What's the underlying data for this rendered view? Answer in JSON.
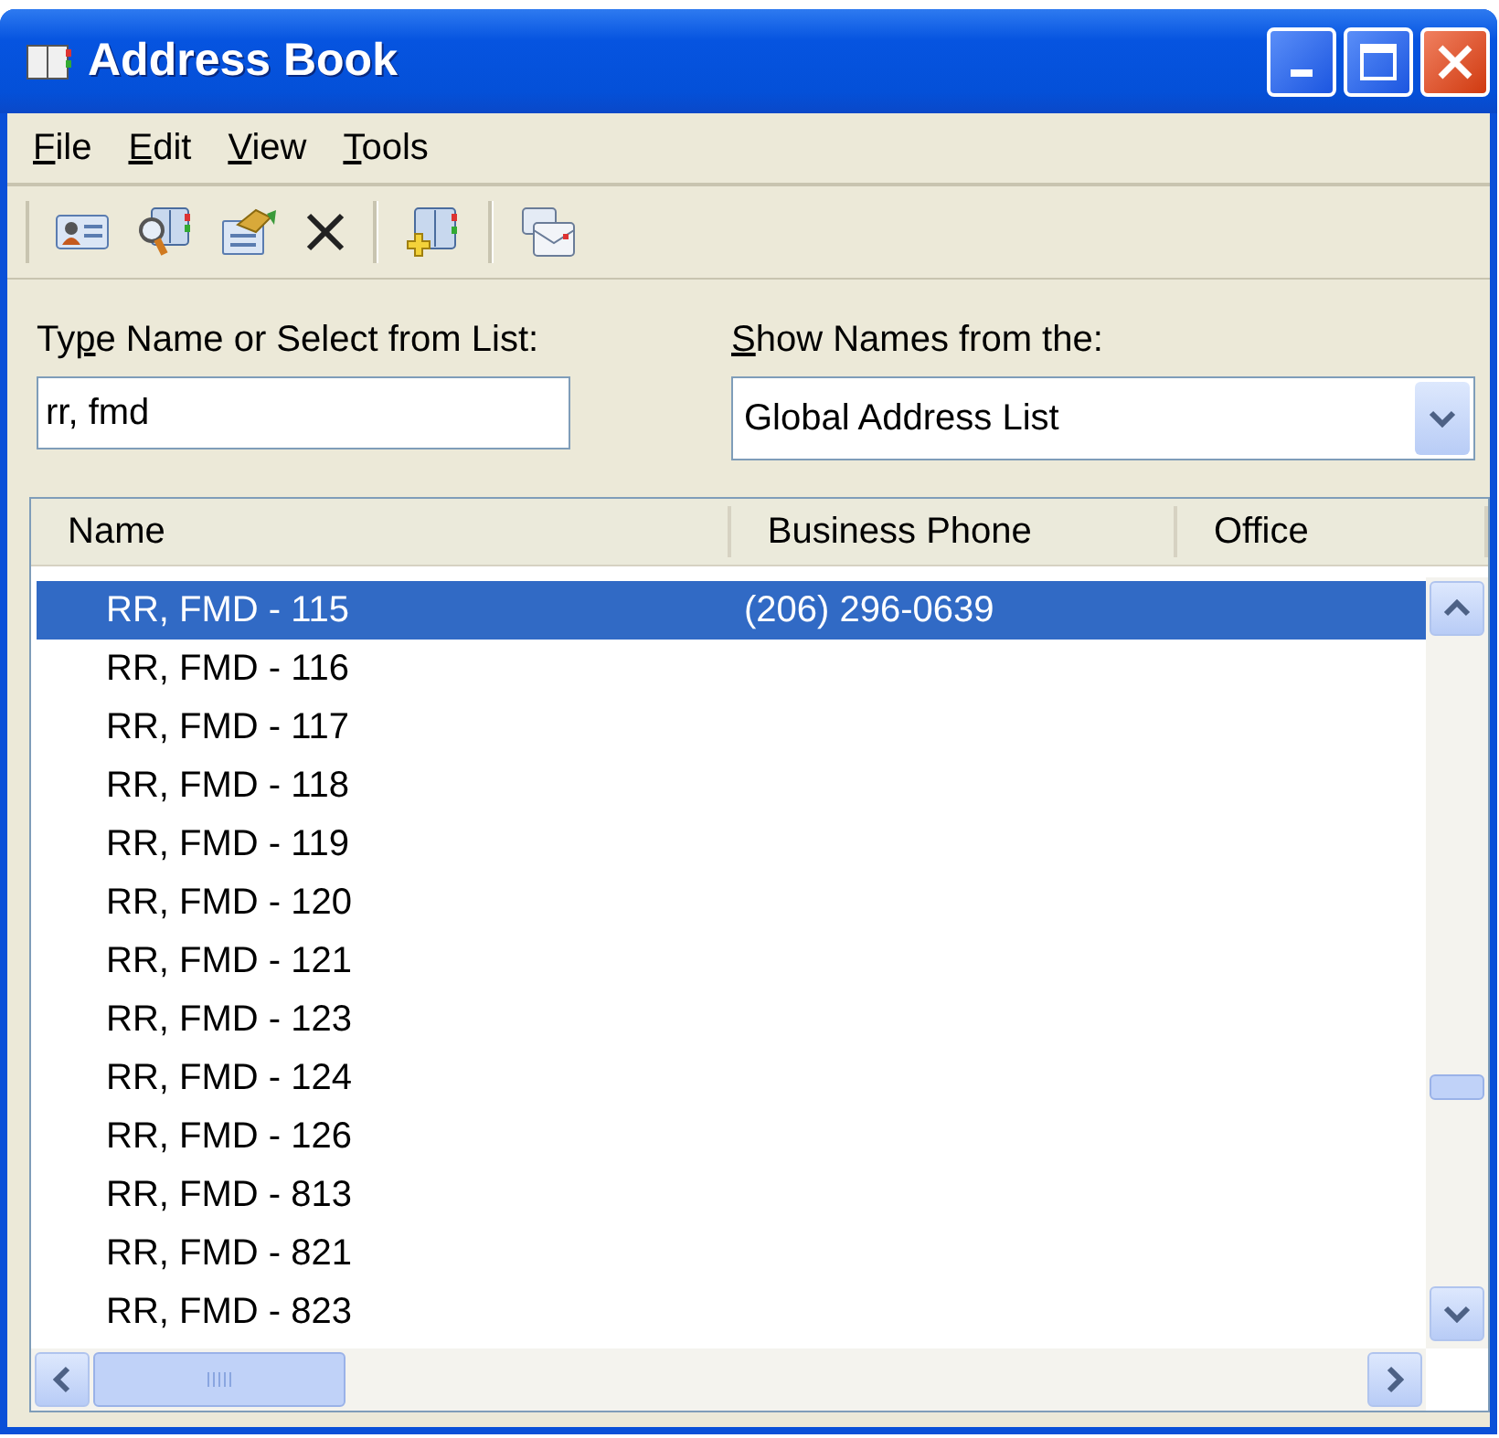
{
  "window": {
    "title": "Address Book"
  },
  "menu": [
    {
      "access_key": "F",
      "label_rest": "ile"
    },
    {
      "access_key": "E",
      "label_rest": "dit"
    },
    {
      "access_key": "V",
      "label_rest": "iew"
    },
    {
      "access_key": "T",
      "label_rest": "ools"
    }
  ],
  "toolbar": [
    {
      "kind": "card"
    },
    {
      "kind": "find"
    },
    {
      "kind": "properties"
    },
    {
      "kind": "delete"
    },
    {
      "kind": "separator"
    },
    {
      "kind": "add-book"
    },
    {
      "kind": "separator"
    },
    {
      "kind": "mail"
    }
  ],
  "search": {
    "label_start": "Ty",
    "access_key": "p",
    "label_rest": "e Name or Select from List:",
    "value": "rr, fmd"
  },
  "source": {
    "access_key": "S",
    "label_rest": "how Names from the:",
    "value": "Global Address List"
  },
  "table": {
    "columns": [
      "Name",
      "Business Phone",
      "Office"
    ],
    "rows": [
      {
        "name": "RR, FMD - 115",
        "phone": "(206) 296-0639",
        "selected": true
      },
      {
        "name": "RR, FMD - 116",
        "selected": false
      },
      {
        "name": "RR, FMD - 117",
        "selected": false
      },
      {
        "name": "RR, FMD - 118",
        "selected": false
      },
      {
        "name": "RR, FMD - 119",
        "selected": false
      },
      {
        "name": "RR, FMD - 120",
        "selected": false
      },
      {
        "name": "RR, FMD - 121",
        "selected": false
      },
      {
        "name": "RR, FMD - 123",
        "selected": false
      },
      {
        "name": "RR, FMD - 124",
        "selected": false
      },
      {
        "name": "RR, FMD - 126",
        "selected": false
      },
      {
        "name": "RR, FMD - 813",
        "selected": false
      },
      {
        "name": "RR, FMD - 821",
        "selected": false
      },
      {
        "name": "RR, FMD - 823",
        "selected": false
      }
    ]
  }
}
